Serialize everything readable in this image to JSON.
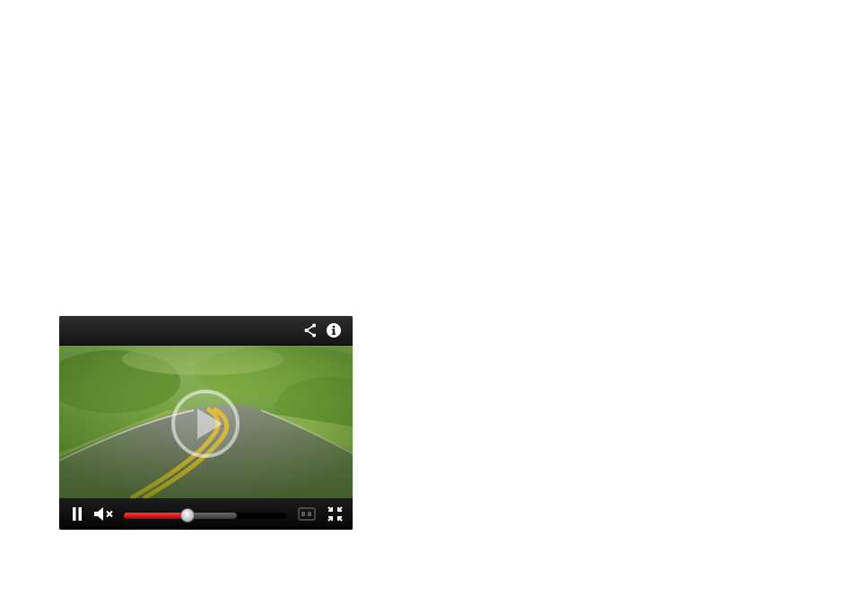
{
  "player": {
    "state": "paused",
    "muted": true,
    "progress": {
      "played_fraction": 0.39,
      "buffered_fraction": 0.69
    },
    "colors": {
      "progress": "#e00000",
      "bar": "#1a1a1a",
      "icon": "#ffffff"
    }
  },
  "topbar": {
    "share_icon": "share-icon",
    "info_icon": "info-icon"
  },
  "controls": {
    "pause_icon": "pause-icon",
    "mute_icon": "volume-muted-icon",
    "quality_icon": "subtitles-icon",
    "fullscreen_icon": "fullscreen-icon"
  },
  "video": {
    "overlay_icon": "play-icon"
  }
}
